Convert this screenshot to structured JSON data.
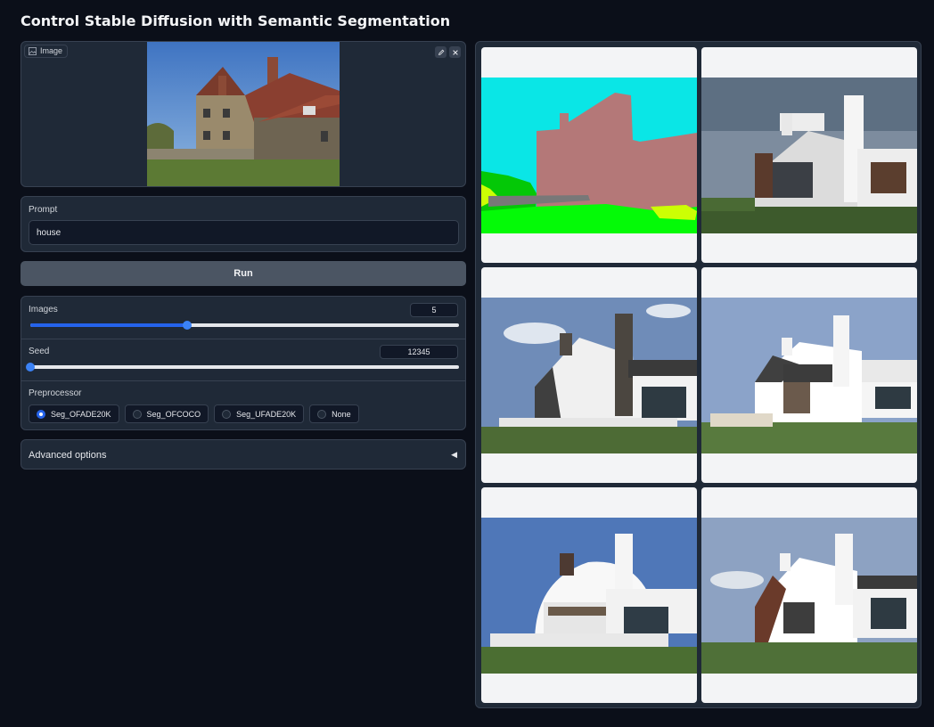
{
  "page": {
    "title": "Control Stable Diffusion with Semantic Segmentation"
  },
  "image_input": {
    "label": "Image",
    "edit_icon": "pencil-icon",
    "clear_icon": "close-icon"
  },
  "prompt": {
    "label": "Prompt",
    "value": "house"
  },
  "run_button": {
    "label": "Run"
  },
  "settings": {
    "images": {
      "label": "Images",
      "value": "5",
      "fraction": 0.366
    },
    "seed": {
      "label": "Seed",
      "value": "12345",
      "fraction": 0.0
    },
    "preprocessor": {
      "label": "Preprocessor",
      "options": [
        "Seg_OFADE20K",
        "Seg_OFCOCO",
        "Seg_UFADE20K",
        "None"
      ],
      "selected": "Seg_OFADE20K"
    }
  },
  "advanced": {
    "label": "Advanced options",
    "arrow": "◀"
  },
  "colors": {
    "background": "#0b0f19",
    "panel": "#1f2937",
    "accent": "#2563eb",
    "seg_sky": "#0ae6e6",
    "seg_building": "#b47878",
    "seg_grass": "#04fa07"
  }
}
